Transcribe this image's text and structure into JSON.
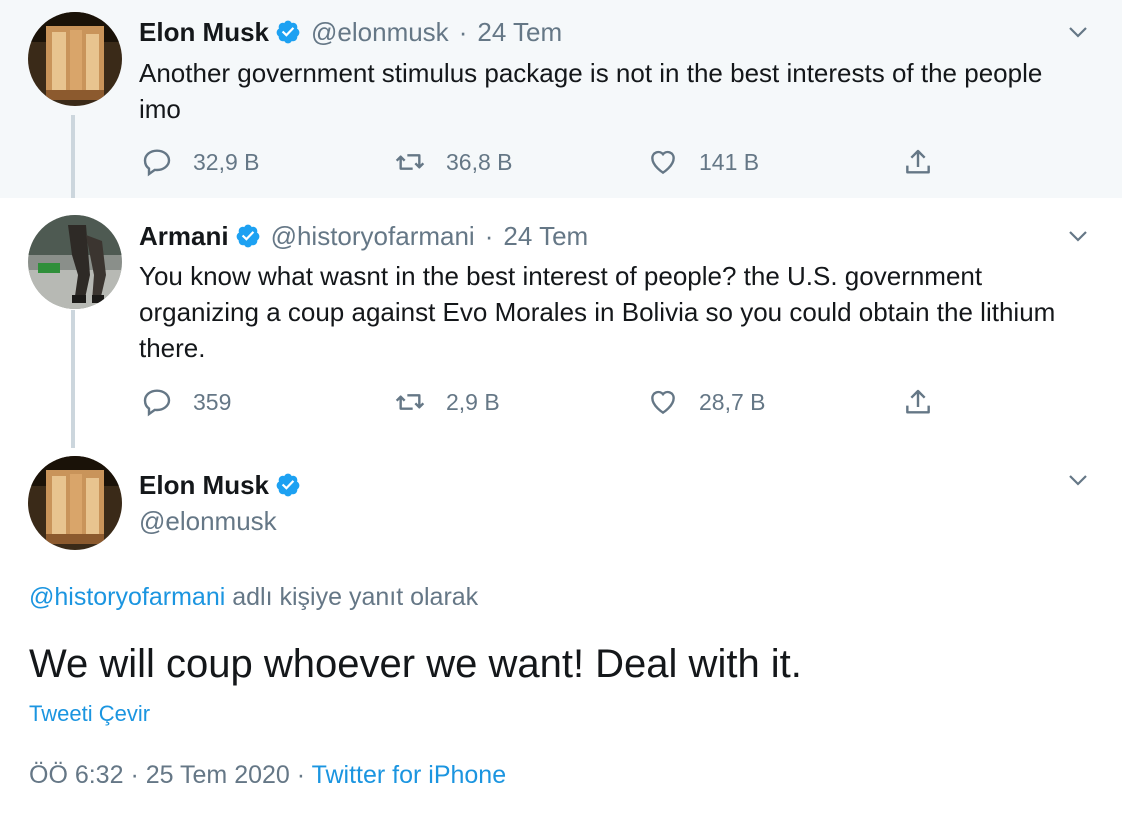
{
  "tweet1": {
    "name": "Elon Musk",
    "handle": "@elonmusk",
    "separator": "·",
    "date": "24 Tem",
    "text": "Another government stimulus package is not in the best interests of the people imo",
    "replies": "32,9 B",
    "retweets": "36,8 B",
    "likes": "141 B"
  },
  "tweet2": {
    "name": "Armani",
    "handle": "@historyofarmani",
    "separator": "·",
    "date": "24 Tem",
    "text": "You know what wasnt in the best interest of people? the U.S. government organizing a coup against Evo Morales in Bolivia so you could obtain the lithium there.",
    "replies": "359",
    "retweets": "2,9 B",
    "likes": "28,7 B"
  },
  "main_tweet": {
    "name": "Elon Musk",
    "handle": "@elonmusk",
    "reply_mention": "@historyofarmani",
    "reply_suffix": " adlı kişiye yanıt olarak",
    "text": "We will coup whoever we want! Deal with it.",
    "translate": "Tweeti Çevir",
    "time": "ÖÖ 6:32 · 25 Tem 2020 · ",
    "source": "Twitter for iPhone"
  },
  "colors": {
    "accent": "#1b95e0",
    "verified": "#1da1f2",
    "muted": "#657786",
    "highlight_bg": "#f5f8fa",
    "thread_line": "#ccd6dd"
  },
  "icons": {
    "reply": "reply-icon",
    "retweet": "retweet-icon",
    "like": "like-icon",
    "share": "share-icon",
    "verified": "verified-badge-icon",
    "menu": "chevron-down-icon"
  }
}
